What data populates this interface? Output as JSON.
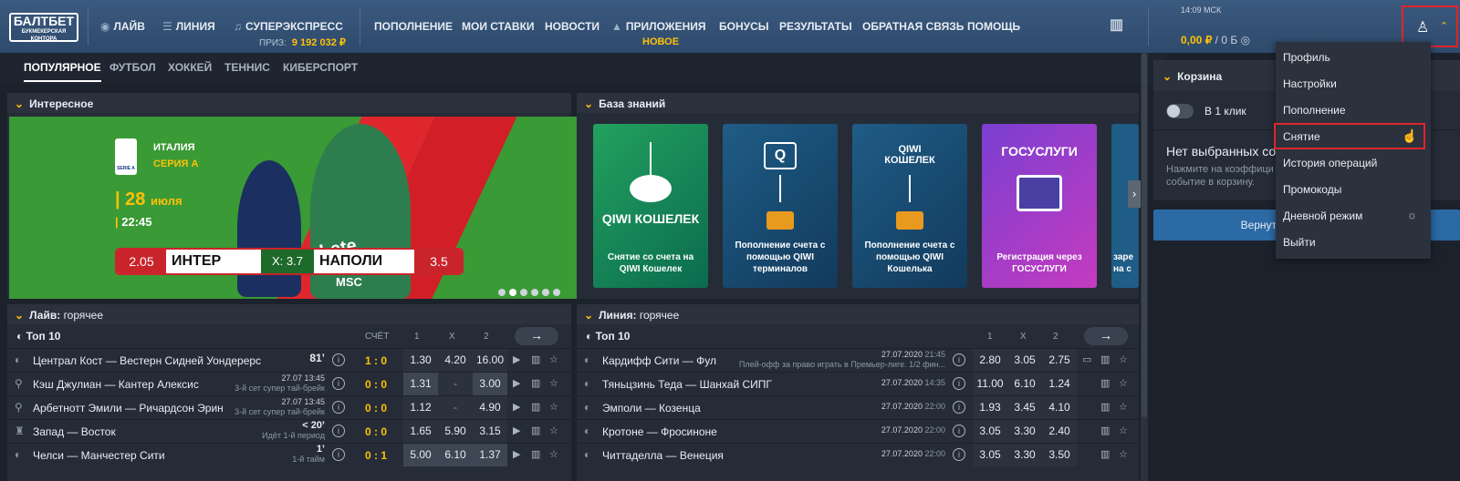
{
  "header": {
    "logo_top": "БАЛТБЕТ",
    "logo_sub": "БУКМЕКЕРСКАЯ КОНТОРА",
    "nav": {
      "live": "ЛАЙВ",
      "line": "ЛИНИЯ",
      "superexpress": "СУПЕРЭКСПРЕСС",
      "deposit": "ПОПОЛНЕНИЕ",
      "my_bets": "МОИ СТАВКИ",
      "news": "НОВОСТИ",
      "apps": "ПРИЛОЖЕНИЯ",
      "bonuses": "БОНУСЫ",
      "results": "РЕЗУЛЬТАТЫ",
      "feedback": "ОБРАТНАЯ СВЯЗЬ",
      "help": "ПОМОЩЬ"
    },
    "prize_label": "ПРИЗ:",
    "prize_value": "9 192 032 ₽",
    "apps_badge": "НОВОЕ",
    "time": "14:09 МСК",
    "balance": "0,00 ₽",
    "bonus": "/ 0 Б"
  },
  "tabs": [
    "ПОПУЛЯРНОЕ",
    "ФУТБОЛ",
    "ХОККЕЙ",
    "ТЕННИС",
    "КИБЕРСПОРТ"
  ],
  "interesting": {
    "title": "Интересное",
    "country": "ИТАЛИЯ",
    "league": "СЕРИЯ А",
    "league_badge": "SERIE A",
    "day": "28",
    "month": "июля",
    "time": "22:45",
    "home_odd": "2.05",
    "home": "ИНТЕР",
    "draw": "X: 3.7",
    "away": "НАПОЛИ",
    "away_odd": "3.5",
    "jersey": "Lete",
    "sponsor": "MSC"
  },
  "knowledge": {
    "title": "База знаний",
    "cards": [
      {
        "title": "Снятие со счета на QIWI Кошелек",
        "logo": "QIWI КОШЕЛЕК"
      },
      {
        "title": "Пополнение счета с помощью QIWI терминалов",
        "logo": "Q"
      },
      {
        "title": "Пополнение счета с помощью QIWI Кошелька",
        "logo": "QIWI КОШЕЛЕК"
      },
      {
        "title": "Регистрация через ГОСУСЛУГИ",
        "logo": "ГОСУСЛУГИ"
      },
      {
        "title": "заре на с",
        "logo": ""
      }
    ]
  },
  "live": {
    "title": "Лайв:",
    "subtitle": "горячее",
    "top": "Топ 10",
    "h_score": "СЧЁТ",
    "h1": "1",
    "hx": "X",
    "h2": "2",
    "go": "→",
    "rows": [
      {
        "name": "Централ Кост — Вестерн Сидней Уондерерс",
        "status": "81’",
        "sub": "",
        "score": "1 : 0",
        "o1": "1.30",
        "ox": "4.20",
        "o2": "16.00"
      },
      {
        "name": "Кэш Джулиан — Кантер Алексис",
        "status": "27.07 13:45",
        "sub": "3-й сет супер тай-брейк",
        "score": "0 : 0",
        "o1": "1.31",
        "ox": "-",
        "o2": "3.00"
      },
      {
        "name": "Арбетнотт Эмили — Ричардсон Эрин",
        "status": "27.07 13:45",
        "sub": "3-й сет супер тай-брейк",
        "score": "0 : 0",
        "o1": "1.12",
        "ox": "-",
        "o2": "4.90"
      },
      {
        "name": "Запад — Восток",
        "status": "< 20’",
        "sub": "Идёт 1-й период",
        "score": "0 : 0",
        "o1": "1.65",
        "ox": "5.90",
        "o2": "3.15"
      },
      {
        "name": "Челси — Манчестер Сити",
        "status": "1’",
        "sub": "1-й тайм",
        "score": "0 : 1",
        "o1": "5.00",
        "ox": "6.10",
        "o2": "1.37"
      }
    ]
  },
  "line": {
    "title": "Линия:",
    "subtitle": "горячее",
    "top": "Топ 10",
    "h1": "1",
    "hx": "X",
    "h2": "2",
    "go": "→",
    "rows": [
      {
        "name": "Кардифф Сити — Фул",
        "date": "27.07.2020",
        "time": "21:45",
        "sub": "Плей-офф за право играть в Премьер-лиге. 1/2 фин...",
        "o1": "2.80",
        "ox": "3.05",
        "o2": "2.75"
      },
      {
        "name": "Тяньцзинь Теда — Шанхай СИПГ",
        "date": "27.07.2020",
        "time": "14:35",
        "sub": "",
        "o1": "11.00",
        "ox": "6.10",
        "o2": "1.24"
      },
      {
        "name": "Эмполи — Козенца",
        "date": "27.07.2020",
        "time": "22:00",
        "sub": "",
        "o1": "1.93",
        "ox": "3.45",
        "o2": "4.10"
      },
      {
        "name": "Кротоне — Фросиноне",
        "date": "27.07.2020",
        "time": "22:00",
        "sub": "",
        "o1": "3.05",
        "ox": "3.30",
        "o2": "2.40"
      },
      {
        "name": "Читтаделла — Венеция",
        "date": "27.07.2020",
        "time": "22:00",
        "sub": "",
        "o1": "3.05",
        "ox": "3.30",
        "o2": "3.50"
      }
    ]
  },
  "cart": {
    "title": "Корзина",
    "one_click": "В 1 клик",
    "empty": "Нет выбранных собы",
    "hint1": "Нажмите на коэффици",
    "hint2": "событие в корзину.",
    "back": "Вернуться на"
  },
  "menu": {
    "items": [
      "Профиль",
      "Настройки",
      "Пополнение",
      "Снятие",
      "История операций",
      "Промокоды",
      "Дневной режим",
      "Выйти"
    ],
    "selected": "Снятие"
  },
  "colors": {
    "accent": "#ffc107",
    "header": "#34527a",
    "highlight": "#e0242b"
  }
}
